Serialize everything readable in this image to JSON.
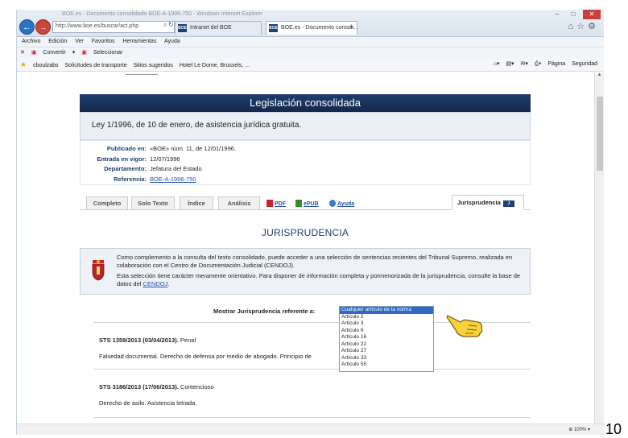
{
  "browser": {
    "window_title": "BOE.es - Documento consolidado BOE-A-1996-750 - Windows Internet Explorer",
    "address": "http://www.boe.es/buscar/act.php",
    "tabs": [
      {
        "label": "Intranet del BOE"
      },
      {
        "label": "BOE.es - Documento consol..."
      }
    ],
    "menu": [
      "Archivo",
      "Edición",
      "Ver",
      "Favoritos",
      "Herramientas",
      "Ayuda"
    ],
    "toolbar": [
      "Convertir",
      "Seleccionar"
    ],
    "favorites": [
      "cboulzabs",
      "Solicitudes de transporte",
      "Sitios sugeridos",
      "Hotel Le Dome, Brussels, ..."
    ],
    "command_bar": [
      "Página",
      "Seguridad"
    ],
    "zoom": "100%"
  },
  "page": {
    "header": "Legislación consolidada",
    "law_title": "Ley 1/1996, de 10 de enero, de asistencia jurídica gratuita.",
    "meta": [
      {
        "key": "Publicado en:",
        "value": "«BOE» núm. 11, de 12/01/1996."
      },
      {
        "key": "Entrada en vigor:",
        "value": "12/07/1996"
      },
      {
        "key": "Departamento:",
        "value": "Jefatura del Estado"
      },
      {
        "key": "Referencia:",
        "value": "BOE-A-1996-750"
      }
    ],
    "tabs": [
      "Completo",
      "Solo Texto",
      "Índice",
      "Análisis"
    ],
    "downloads": [
      "PDF",
      "ePUB",
      "Ayuda"
    ],
    "active_tab": "Jurisprudencia",
    "active_tab_badge": "J",
    "section_title": "JURISPRUDENCIA",
    "info_p1": "Como complemento a la consulta del texto consolidado, puede acceder a una selección de sentencias recientes del Tribunal Supremo, realizada en colaboración con el Centro de Documentación Judicial (CENDOJ).",
    "info_p2_pre": "Esta selección tiene carácter meramente orientativo. Para disponer de información completa y pormenorizada de la jurisprudencia, consulte la base de datos del ",
    "info_p2_link": "CENDOJ",
    "info_p2_post": ".",
    "filter_label": "Mostrar Jurisprudencia referente a:",
    "filter_options": [
      "Cualquier artículo de la norma",
      "Artículo 2",
      "Artículo 3",
      "Artículo 6",
      "Artículo 16",
      "Artículo 22",
      "Artículo 27",
      "Artículo 33",
      "Artículo 55"
    ],
    "results": [
      {
        "title": "STS 1359/2013 (03/04/2013).",
        "type": "Penal",
        "desc": "Falsedad documental. Derecho de defensa por medio de abogado. Principio de"
      },
      {
        "title": "STS 3186/2013 (17/06/2013).",
        "type": "Contencioso",
        "desc": "Derecho de asilo. Asistencia letrada."
      }
    ]
  },
  "slide_number": "10"
}
